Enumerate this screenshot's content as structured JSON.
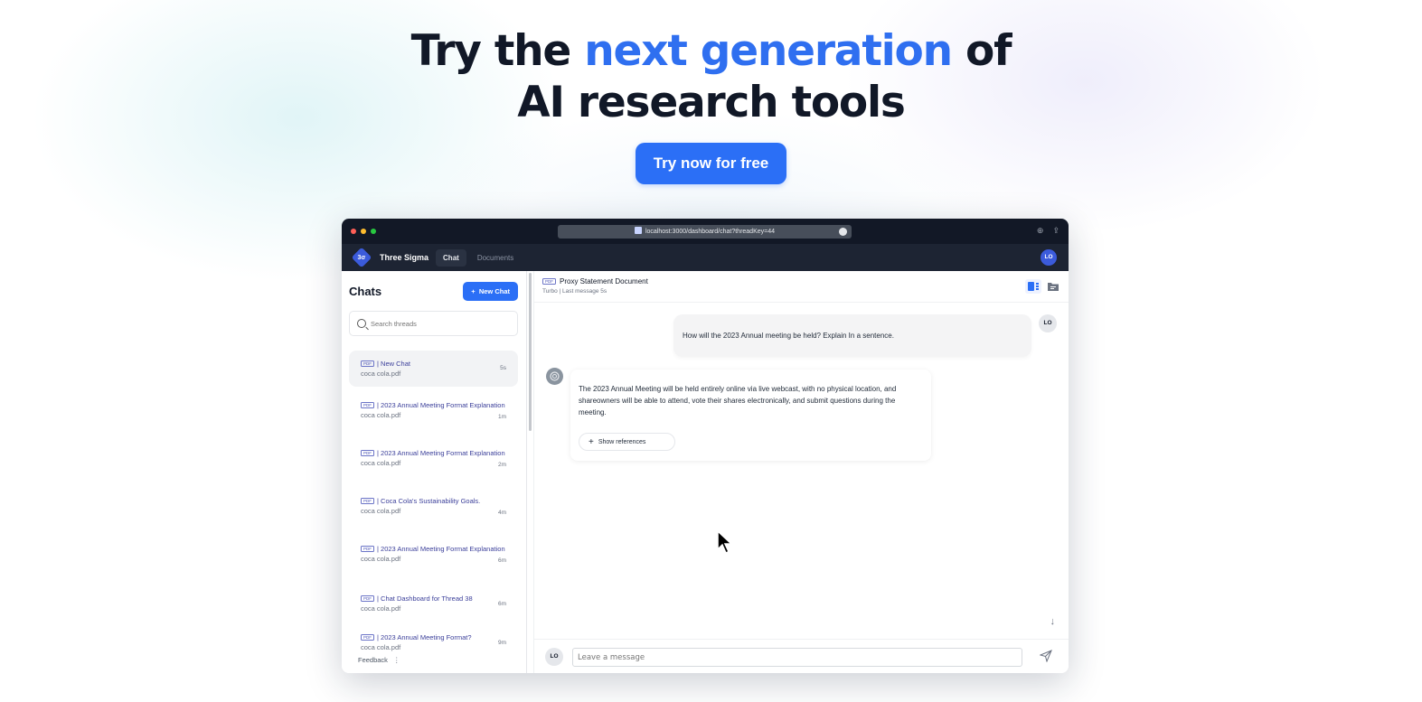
{
  "hero": {
    "title_before": "Try the ",
    "title_accent": "next generation",
    "title_after": " of",
    "title_line2": "AI research tools",
    "cta_label": "Try now for free",
    "accent_color": "#2f6ff0"
  },
  "browser": {
    "url": "localhost:3000/dashboard/chat?threadKey=44",
    "traffic_lights": [
      "#ff5f57",
      "#febc2e",
      "#28c840"
    ]
  },
  "app": {
    "logo_text": "3σ",
    "brand": "Three Sigma",
    "nav": [
      {
        "label": "Chat",
        "active": true
      },
      {
        "label": "Documents",
        "active": false
      }
    ],
    "user_initials": "LO"
  },
  "sidebar": {
    "title": "Chats",
    "new_chat_label": "New Chat",
    "search_placeholder": "Search threads",
    "pdf_badge": "PDF",
    "threads": [
      {
        "title": "| New Chat",
        "file": "coca cola.pdf",
        "time": "5s",
        "active": true
      },
      {
        "title": "| 2023 Annual Meeting Format Explanation",
        "file": "coca cola.pdf",
        "time": "1m"
      },
      {
        "title": "| 2023 Annual Meeting Format Explanation",
        "file": "coca cola.pdf",
        "time": "2m"
      },
      {
        "title": "| Coca Cola's Sustainability Goals.",
        "file": "coca cola.pdf",
        "time": "4m"
      },
      {
        "title": "| 2023 Annual Meeting Format Explanation",
        "file": "coca cola.pdf",
        "time": "6m"
      },
      {
        "title": "| Chat Dashboard for Thread 38",
        "file": "coca cola.pdf",
        "time": "6m"
      },
      {
        "title": "| 2023 Annual Meeting Format?",
        "file": "coca cola.pdf",
        "time": "9m"
      }
    ],
    "feedback_label": "Feedback"
  },
  "chat": {
    "doc_title": "Proxy Statement Document",
    "doc_sub": "Turbo | Last message 5s",
    "user_message": "How will the 2023 Annual meeting be held? Explain In a sentence.",
    "bot_message": "The 2023 Annual Meeting will be held entirely online via live webcast, with no physical location, and shareowners will be able to attend, vote their shares electronically, and submit questions during the meeting.",
    "show_references_label": "Show references",
    "input_placeholder": "Leave a message",
    "user_initials": "LO"
  }
}
